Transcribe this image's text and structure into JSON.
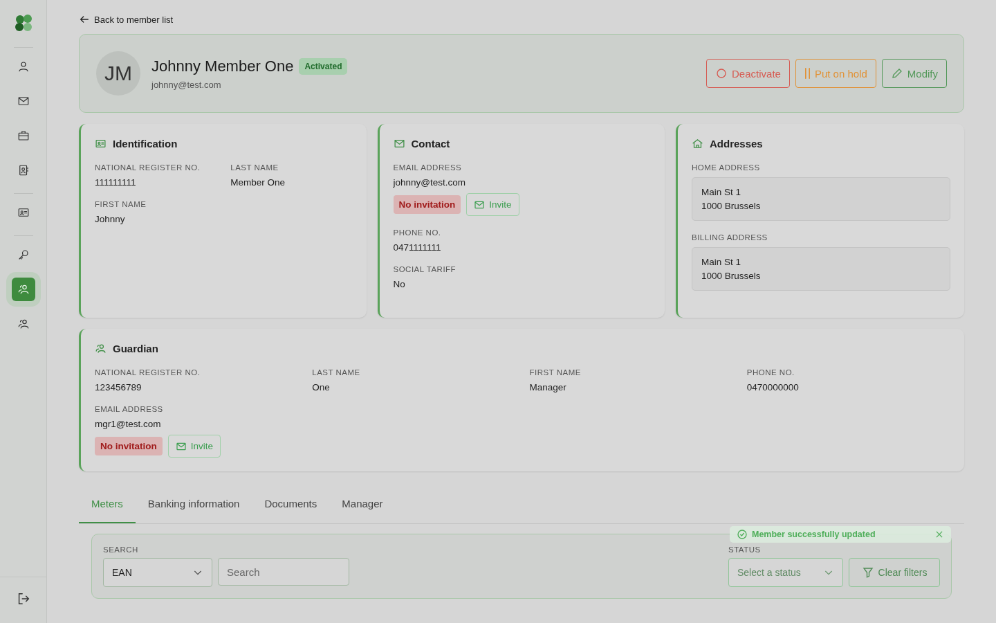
{
  "sidebar": {
    "groups": [
      [
        {
          "selected": false
        },
        {
          "selected": false
        },
        {
          "selected": false
        },
        {
          "selected": false
        }
      ],
      [
        {
          "selected": false
        }
      ],
      [
        {
          "selected": false
        },
        {
          "selected": true
        },
        {
          "selected": false
        }
      ]
    ]
  },
  "back_link": "Back to member list",
  "member": {
    "initials": "JM",
    "name": "Johnny Member One",
    "status": "Activated",
    "email": "johnny@test.com"
  },
  "actions": [
    {
      "label": "Deactivate",
      "kind": "danger"
    },
    {
      "label": "Put on hold",
      "kind": "warning"
    },
    {
      "label": "Modify",
      "kind": "primary"
    }
  ],
  "cards": [
    {
      "title": "Identification",
      "kind": "identification",
      "fields": [
        {
          "label": "NATIONAL REGISTER NO.",
          "value": "111111111"
        },
        {
          "label": "LAST NAME",
          "value": "Member One"
        },
        {
          "label": "FIRST NAME",
          "value": "Johnny"
        }
      ]
    },
    {
      "title": "Contact",
      "kind": "contact",
      "fields": [
        {
          "label": "EMAIL ADDRESS",
          "value": "johnny@test.com",
          "invitation": {
            "status": "No invitation",
            "button": "Invite"
          }
        },
        {
          "label": "PHONE NO.",
          "value": "0471111111"
        },
        {
          "label": "SOCIAL TARIFF",
          "value": "No"
        }
      ]
    },
    {
      "title": "Addresses",
      "kind": "addresses",
      "addresses": [
        {
          "label": "HOME ADDRESS",
          "lines": [
            "Main St 1",
            "1000 Brussels"
          ]
        },
        {
          "label": "BILLING ADDRESS",
          "lines": [
            "Main St 1",
            "1000 Brussels"
          ]
        }
      ]
    }
  ],
  "guardian": {
    "title": "Guardian",
    "fields": [
      {
        "label": "NATIONAL REGISTER NO.",
        "value": "123456789"
      },
      {
        "label": "LAST NAME",
        "value": "One"
      },
      {
        "label": "FIRST NAME",
        "value": "Manager"
      },
      {
        "label": "PHONE NO.",
        "value": "0470000000"
      },
      {
        "label": "EMAIL ADDRESS",
        "value": "mgr1@test.com",
        "invitation": {
          "status": "No invitation",
          "button": "Invite"
        }
      }
    ]
  },
  "tabs": [
    {
      "label": "Meters",
      "selected": true
    },
    {
      "label": "Banking information",
      "selected": false
    },
    {
      "label": "Documents",
      "selected": false
    },
    {
      "label": "Manager",
      "selected": false
    }
  ],
  "filters": {
    "search_label": "SEARCH",
    "search_type": "EAN",
    "search_placeholder": "Search",
    "status_label": "STATUS",
    "status_placeholder": "Select a status",
    "clear_button": "Clear filters"
  },
  "toast": {
    "message": "Member successfully updated"
  }
}
